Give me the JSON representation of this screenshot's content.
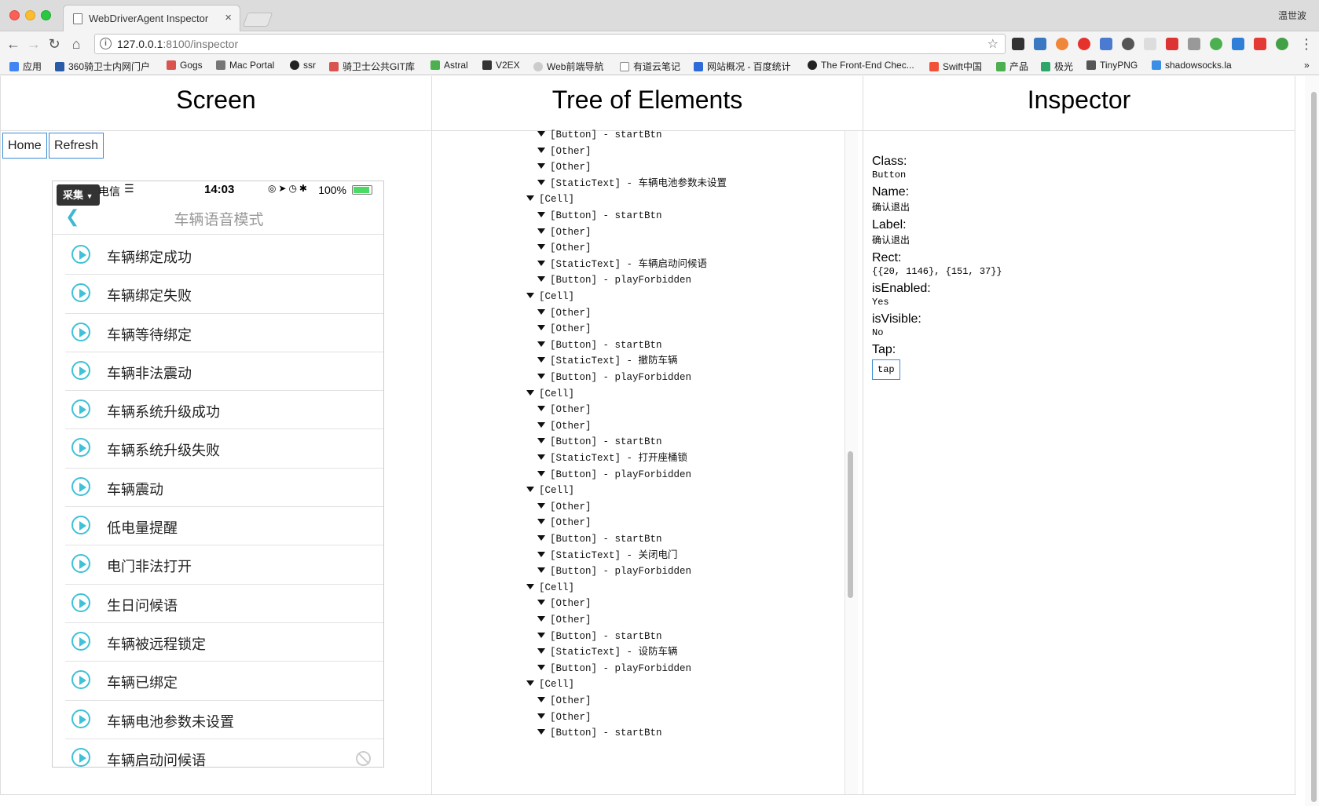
{
  "browser": {
    "tab_title": "WebDriverAgent Inspector",
    "tab_close": "×",
    "user": "温世波",
    "url_host": "127.0.0.1",
    "url_path": ":8100/inspector",
    "bookmarks": [
      "应用",
      "360骑卫士内网门户",
      "Gogs",
      "Mac Portal",
      "ssr",
      "骑卫士公共GIT库",
      "Astral",
      "V2EX",
      "Web前端导航",
      "有道云笔记",
      "网站概况 - 百度统计",
      "The Front-End Chec...",
      "Swift中国",
      "产品",
      "极光",
      "TinyPNG",
      "shadowsocks.la"
    ],
    "bookmarks_more": "»"
  },
  "columns": {
    "screen": "Screen",
    "tree": "Tree of Elements",
    "inspector": "Inspector"
  },
  "screen": {
    "home_label": "Home",
    "refresh_label": "Refresh",
    "status": {
      "carrier": "电信",
      "time": "14:03",
      "battery": "100%"
    },
    "overlay": "采集",
    "nav_title": "车辆语音模式",
    "rows": [
      "车辆绑定成功",
      "车辆绑定失败",
      "车辆等待绑定",
      "车辆非法震动",
      "车辆系统升级成功",
      "车辆系统升级失败",
      "车辆震动",
      "低电量提醒",
      "电门非法打开",
      "生日问候语",
      "车辆被远程锁定",
      "车辆已绑定",
      "车辆电池参数未设置",
      "车辆启动问候语"
    ]
  },
  "tree": {
    "nodes": [
      {
        "indent": 1,
        "text": "[Button] - startBtn"
      },
      {
        "indent": 1,
        "text": "[Other]"
      },
      {
        "indent": 1,
        "text": "[Other]"
      },
      {
        "indent": 1,
        "text": "[StaticText] - 车辆电池参数未设置"
      },
      {
        "indent": 0,
        "text": "[Cell]"
      },
      {
        "indent": 1,
        "text": "[Button] - startBtn"
      },
      {
        "indent": 1,
        "text": "[Other]"
      },
      {
        "indent": 1,
        "text": "[Other]"
      },
      {
        "indent": 1,
        "text": "[StaticText] - 车辆启动问候语"
      },
      {
        "indent": 1,
        "text": "[Button] - playForbidden"
      },
      {
        "indent": 0,
        "text": "[Cell]"
      },
      {
        "indent": 1,
        "text": "[Other]"
      },
      {
        "indent": 1,
        "text": "[Other]"
      },
      {
        "indent": 1,
        "text": "[Button] - startBtn"
      },
      {
        "indent": 1,
        "text": "[StaticText] - 撤防车辆"
      },
      {
        "indent": 1,
        "text": "[Button] - playForbidden"
      },
      {
        "indent": 0,
        "text": "[Cell]"
      },
      {
        "indent": 1,
        "text": "[Other]"
      },
      {
        "indent": 1,
        "text": "[Other]"
      },
      {
        "indent": 1,
        "text": "[Button] - startBtn"
      },
      {
        "indent": 1,
        "text": "[StaticText] - 打开座桶锁"
      },
      {
        "indent": 1,
        "text": "[Button] - playForbidden"
      },
      {
        "indent": 0,
        "text": "[Cell]"
      },
      {
        "indent": 1,
        "text": "[Other]"
      },
      {
        "indent": 1,
        "text": "[Other]"
      },
      {
        "indent": 1,
        "text": "[Button] - startBtn"
      },
      {
        "indent": 1,
        "text": "[StaticText] - 关闭电门"
      },
      {
        "indent": 1,
        "text": "[Button] - playForbidden"
      },
      {
        "indent": 0,
        "text": "[Cell]"
      },
      {
        "indent": 1,
        "text": "[Other]"
      },
      {
        "indent": 1,
        "text": "[Other]"
      },
      {
        "indent": 1,
        "text": "[Button] - startBtn"
      },
      {
        "indent": 1,
        "text": "[StaticText] - 设防车辆"
      },
      {
        "indent": 1,
        "text": "[Button] - playForbidden"
      },
      {
        "indent": 0,
        "text": "[Cell]"
      },
      {
        "indent": 1,
        "text": "[Other]"
      },
      {
        "indent": 1,
        "text": "[Other]"
      },
      {
        "indent": 1,
        "text": "[Button] - startBtn"
      }
    ]
  },
  "inspector": {
    "props": [
      {
        "key": "Class:",
        "value": "Button"
      },
      {
        "key": "Name:",
        "value": "确认退出"
      },
      {
        "key": "Label:",
        "value": "确认退出"
      },
      {
        "key": "Rect:",
        "value": "{{20, 1146}, {151, 37}}"
      },
      {
        "key": "isEnabled:",
        "value": "Yes"
      },
      {
        "key": "isVisible:",
        "value": "No"
      }
    ],
    "tap_key": "Tap:",
    "tap_label": "tap"
  }
}
